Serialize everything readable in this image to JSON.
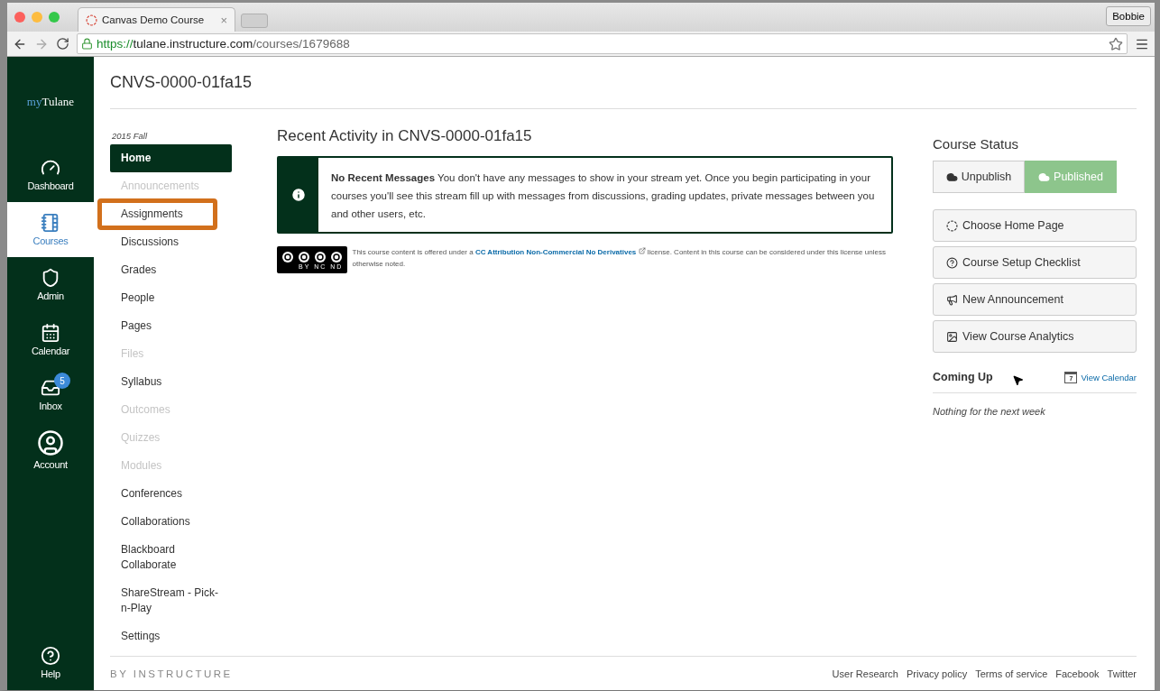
{
  "browser": {
    "tab_title": "Canvas Demo Course",
    "tab_close": "×",
    "profile": "Bobbie",
    "url_scheme": "https://",
    "url_host": "tulane.instructure.com",
    "url_path": "/courses/1679688"
  },
  "global_nav": {
    "logo_prefix": "my",
    "logo_name": "Tulane",
    "items": [
      {
        "label": "Dashboard",
        "kind": "dashboard",
        "selected": false
      },
      {
        "label": "Courses",
        "kind": "courses",
        "selected": true
      },
      {
        "label": "Admin",
        "kind": "admin",
        "selected": false
      },
      {
        "label": "Calendar",
        "kind": "calendar",
        "selected": false
      },
      {
        "label": "Inbox",
        "kind": "inbox",
        "selected": false,
        "badge": "5"
      },
      {
        "label": "Account",
        "kind": "account",
        "selected": false
      }
    ],
    "help": "Help"
  },
  "course_title": "CNVS-0000-01fa15",
  "course_nav": {
    "term": "2015 Fall",
    "items": [
      {
        "label": "Home",
        "selected": true,
        "disabled": false,
        "highlighted": false
      },
      {
        "label": "Announcements",
        "selected": false,
        "disabled": true,
        "highlighted": false
      },
      {
        "label": "Assignments",
        "selected": false,
        "disabled": false,
        "highlighted": true
      },
      {
        "label": "Discussions",
        "selected": false,
        "disabled": false,
        "highlighted": false
      },
      {
        "label": "Grades",
        "selected": false,
        "disabled": false,
        "highlighted": false
      },
      {
        "label": "People",
        "selected": false,
        "disabled": false,
        "highlighted": false
      },
      {
        "label": "Pages",
        "selected": false,
        "disabled": false,
        "highlighted": false
      },
      {
        "label": "Files",
        "selected": false,
        "disabled": true,
        "highlighted": false
      },
      {
        "label": "Syllabus",
        "selected": false,
        "disabled": false,
        "highlighted": false
      },
      {
        "label": "Outcomes",
        "selected": false,
        "disabled": true,
        "highlighted": false
      },
      {
        "label": "Quizzes",
        "selected": false,
        "disabled": true,
        "highlighted": false
      },
      {
        "label": "Modules",
        "selected": false,
        "disabled": true,
        "highlighted": false
      },
      {
        "label": "Conferences",
        "selected": false,
        "disabled": false,
        "highlighted": false
      },
      {
        "label": "Collaborations",
        "selected": false,
        "disabled": false,
        "highlighted": false
      },
      {
        "label": "Blackboard Collaborate",
        "selected": false,
        "disabled": false,
        "highlighted": false
      },
      {
        "label": "ShareStream - Pick-n-Play",
        "selected": false,
        "disabled": false,
        "highlighted": false
      },
      {
        "label": "Settings",
        "selected": false,
        "disabled": false,
        "highlighted": false
      }
    ]
  },
  "recent_activity": {
    "heading": "Recent Activity in CNVS-0000-01fa15",
    "message": "**No Recent Messages**  You don't have any messages to show in your stream yet. Once you begin participating in your courses you'll see this stream fill up with messages from discussions, grading updates, private messages between you and other users, etc.",
    "license_before": "This course content is offered under a ",
    "license_link": "CC Attribution Non-Commercial No Derivatives",
    "license_after": " license. Content in this course can be considered under this license unless otherwise noted.",
    "license_badge": [
      "BY",
      "NC",
      "ND"
    ]
  },
  "course_status": {
    "heading": "Course Status",
    "publish": [
      {
        "label": "Unpublish",
        "selected": false
      },
      {
        "label": "Published",
        "selected": true
      }
    ],
    "actions": [
      {
        "label": "Choose Home Page",
        "kind": "home"
      },
      {
        "label": "Course Setup Checklist",
        "kind": "checklist"
      },
      {
        "label": "New Announcement",
        "kind": "announcement"
      },
      {
        "label": "View Course Analytics",
        "kind": "analytics"
      }
    ],
    "coming_up": "Coming Up",
    "calendar_day": "7",
    "view_calendar": "View Calendar",
    "empty": "Nothing for the next week"
  },
  "footer": {
    "brand": "BY INSTRUCTURE",
    "links": [
      "User Research",
      "Privacy policy",
      "Terms of service",
      "Facebook",
      "Twitter"
    ]
  }
}
